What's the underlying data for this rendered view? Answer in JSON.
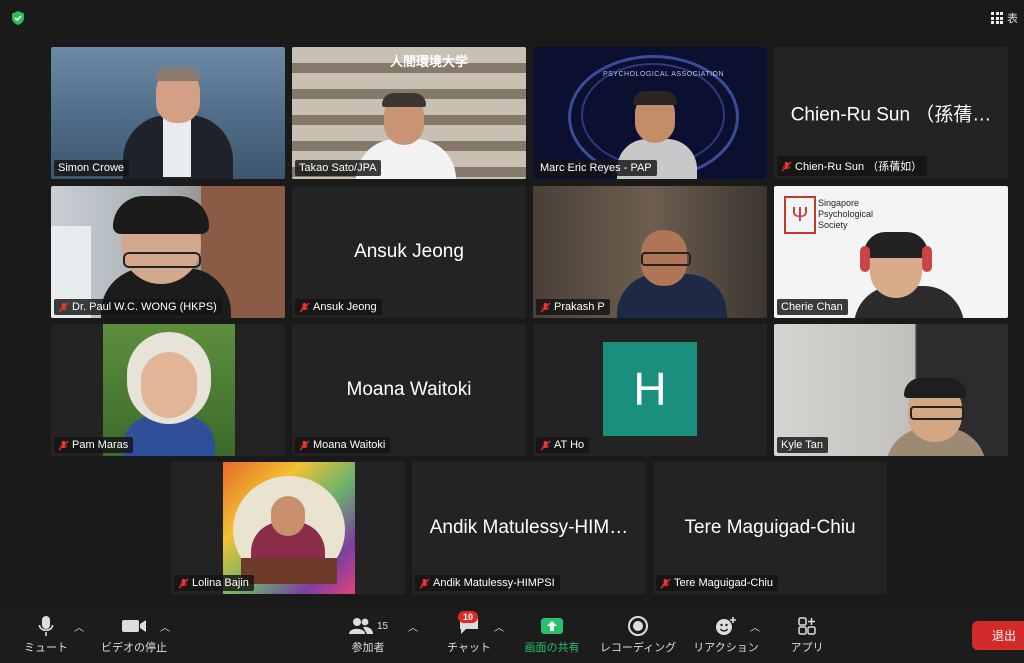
{
  "window": {
    "view_label": "表"
  },
  "participants": [
    {
      "name": "Simon Crowe",
      "muted": false,
      "video": true
    },
    {
      "name": "Takao Sato/JPA",
      "muted": false,
      "video": true,
      "sign_text": "人間環境大学"
    },
    {
      "name": "Marc Eric Reyes - PAP",
      "muted": false,
      "video": true,
      "speaking": true,
      "logo_text": "PSYCHOLOGICAL ASSOCIATION"
    },
    {
      "name": "Chien-Ru Sun （孫蒨如）",
      "display": "Chien-Ru Sun （孫蒨…",
      "muted": true,
      "video": false
    },
    {
      "name": "Dr. Paul W.C. WONG (HKPS)",
      "muted": true,
      "video": true
    },
    {
      "name": "Ansuk Jeong",
      "display": "Ansuk Jeong",
      "muted": true,
      "video": false
    },
    {
      "name": "Prakash P",
      "muted": true,
      "video": true
    },
    {
      "name": "Cherie Chan",
      "muted": false,
      "video": true,
      "logo_text": [
        "Singapore",
        "Psychological",
        "Society"
      ]
    },
    {
      "name": "Pam Maras",
      "muted": true,
      "video": true
    },
    {
      "name": "Moana Waitoki",
      "display": "Moana Waitoki",
      "muted": true,
      "video": false
    },
    {
      "name": "AT Ho",
      "avatar_letter": "H",
      "muted": true,
      "video": false
    },
    {
      "name": "Kyle Tan",
      "muted": false,
      "video": true
    },
    {
      "name": "Lolina Bajin",
      "muted": true,
      "video": true
    },
    {
      "name": "Andik Matulessy-HIMPSI",
      "display": "Andik Matulessy-HIM…",
      "muted": true,
      "video": false
    },
    {
      "name": "Tere Maguigad-Chiu",
      "display": "Tere Maguigad-Chiu",
      "muted": true,
      "video": false
    }
  ],
  "toolbar": {
    "mute_label": "ミュート",
    "video_label": "ビデオの停止",
    "participants_label": "参加者",
    "participants_count": "15",
    "chat_label": "チャット",
    "chat_badge": "10",
    "share_label": "画面の共有",
    "record_label": "レコーディング",
    "reaction_label": "リアクション",
    "apps_label": "アプリ",
    "leave_label": "退出"
  },
  "colors": {
    "speaking": "#3ec25a",
    "share": "#29c16b",
    "avatar_bg": "#1a8f7e",
    "leave": "#d32b2b",
    "badge": "#e02828"
  }
}
